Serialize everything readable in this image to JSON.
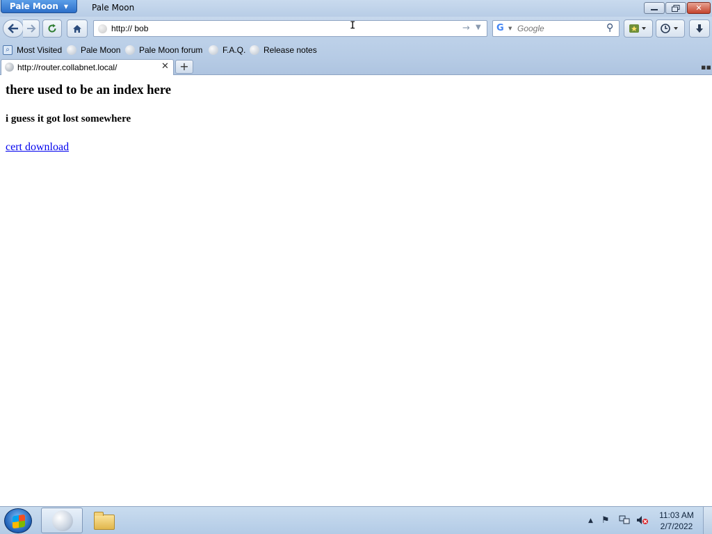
{
  "window": {
    "app_button_label": "Pale Moon",
    "title": "Pale Moon",
    "close_glyph": "✕"
  },
  "navbar": {
    "url_value": "http:// bob",
    "search_placeholder": "Google",
    "search_engine_letter": "G"
  },
  "bookmarks": [
    {
      "label": "Most Visited",
      "icon": "most-visited-icon"
    },
    {
      "label": "Pale Moon",
      "icon": "globe-icon"
    },
    {
      "label": "Pale Moon forum",
      "icon": "globe-icon"
    },
    {
      "label": "F.A.Q.",
      "icon": "globe-icon"
    },
    {
      "label": "Release notes",
      "icon": "globe-icon"
    }
  ],
  "tabs": [
    {
      "label": "http://router.collabnet.local/"
    }
  ],
  "page": {
    "heading": "there used to be an index here",
    "subheading": "i guess it got lost somewhere",
    "link_text": "cert download"
  },
  "taskbar": {
    "clock_time": "11:03 AM",
    "clock_date": "2/7/2022"
  },
  "colors": {
    "link": "#0000ee",
    "chrome": "#bcd0e8",
    "app_button": "#2c6fc9",
    "close_button": "#c4432d"
  }
}
